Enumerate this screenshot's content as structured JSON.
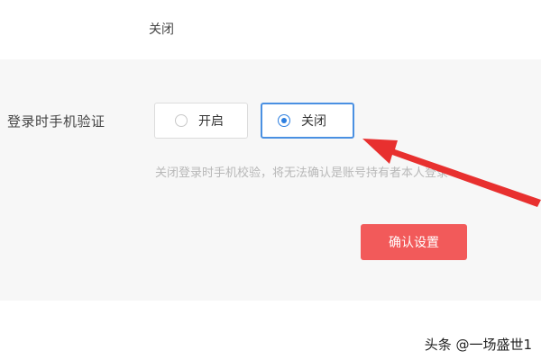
{
  "top_status_text": "关闭",
  "setting": {
    "label": "登录时手机验证",
    "options": [
      {
        "label": "开启",
        "selected": false
      },
      {
        "label": "关闭",
        "selected": true
      }
    ],
    "hint": "关闭登录时手机校验，将无法确认是账号持有者本人登录"
  },
  "confirm_label": "确认设置",
  "watermark": "头条 @一场盛世1",
  "colors": {
    "accent_blue": "#2d7fe0",
    "confirm_red": "#f25a5a",
    "annotation_arrow": "#e8302f"
  }
}
